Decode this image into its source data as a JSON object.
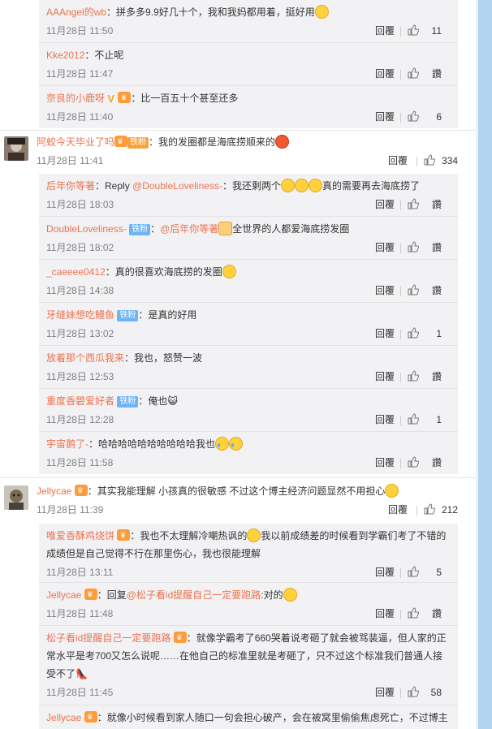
{
  "labels": {
    "reply": "回覆",
    "like": "讚"
  },
  "colors": {
    "name": "#eb7350",
    "bg": "#f2f2f5",
    "fan_badge": "#6cb4f5",
    "scrollbar": "#b0d4ef"
  },
  "group1": [
    {
      "name": "AAAngel的wb",
      "text": "：拼多多9.9好几十个，我和我妈都用着，挺好用",
      "time": "11月28日 11:50",
      "likes": "11"
    },
    {
      "name": "Kke2012",
      "text": "：不止呢",
      "time": "11月28日 11:47",
      "likes": "讚"
    },
    {
      "name": "奈良的小鹿呀",
      "text": "：比一百五十个甚至还多",
      "time": "11月28日 11:40",
      "likes": "6"
    }
  ],
  "comment1": {
    "name": "阿蛟今天毕业了吗",
    "badge": "铁粉",
    "text": "：我的发圈都是海底捞顺来的",
    "time": "11月28日 11:41",
    "likes": "334"
  },
  "group2": [
    {
      "name": "后年你等著",
      "text_pre": "：Reply ",
      "at": "@DoubleLoveliness-",
      "text": "：我还剩两个",
      "text_post": "真的需要再去海底捞了",
      "time": "11月28日 18:03",
      "likes": "讚"
    },
    {
      "name": "DoubleLoveliness-",
      "badge": "铁粉",
      "text_pre": "：",
      "at": "@后年你等著",
      "text": "全世界的人都爱海底捞发圈",
      "time": "11月28日 18:02",
      "likes": "讚"
    },
    {
      "name": "_caeeee0412",
      "text": "：真的很喜欢海底捞的发圈",
      "time": "11月28日 14:38",
      "likes": "讚"
    },
    {
      "name": "牙缝妹想吃鳗鱼",
      "badge": "铁粉",
      "text": "：是真的好用",
      "time": "11月28日 13:02",
      "likes": "1"
    },
    {
      "name": "放着那个西瓜我来",
      "text": "：我也，怒赞一波",
      "time": "11月28日 12:53",
      "likes": "讚"
    },
    {
      "name": "重度香碧爱好者",
      "badge": "铁粉",
      "text": "：俺也",
      "time": "11月28日 12:28",
      "likes": "1"
    },
    {
      "name": "宇宙鹅了-",
      "text": "：哈哈哈哈哈哈哈哈哈哈我也",
      "time": "11月28日 11:58",
      "likes": "讚"
    }
  ],
  "comment2": {
    "name": "Jellycae",
    "text": "：其实我能理解 小孩真的很敏感 不过这个博主经济问题显然不用担心",
    "time": "11月28日 11:39",
    "likes": "212"
  },
  "group3": [
    {
      "name": "唯爱香酥鸡烧饼",
      "text": "：我也不太理解冷嘲热讽的",
      "text2": "我以前成绩差的时候看到学霸们考了不错的成绩但是自己觉得不行在那里伤心，我也很能理解",
      "time": "11月28日 13:11",
      "likes": "5"
    },
    {
      "name": "Jellycae",
      "text_pre": "：回复",
      "at": "@松子看id提醒自己一定要跑路",
      "text": ":对的",
      "time": "11月28日 11:48",
      "likes": "讚"
    },
    {
      "name": "松子看id提醒自己一定要跑路",
      "text": "：就像学霸考了660哭着说考砸了就会被骂装逼，但人家的正常水平是考700又怎么说呢……在他自己的标准里就是考砸了，只不过这个标准我们普通人接受不了",
      "time": "11月28日 11:45",
      "likes": "58"
    },
    {
      "name": "Jellycae",
      "text": "：就像小时候看到家人随口一句会担心破产，会在被窝里偷偷焦虑死亡，不过博主"
    }
  ]
}
